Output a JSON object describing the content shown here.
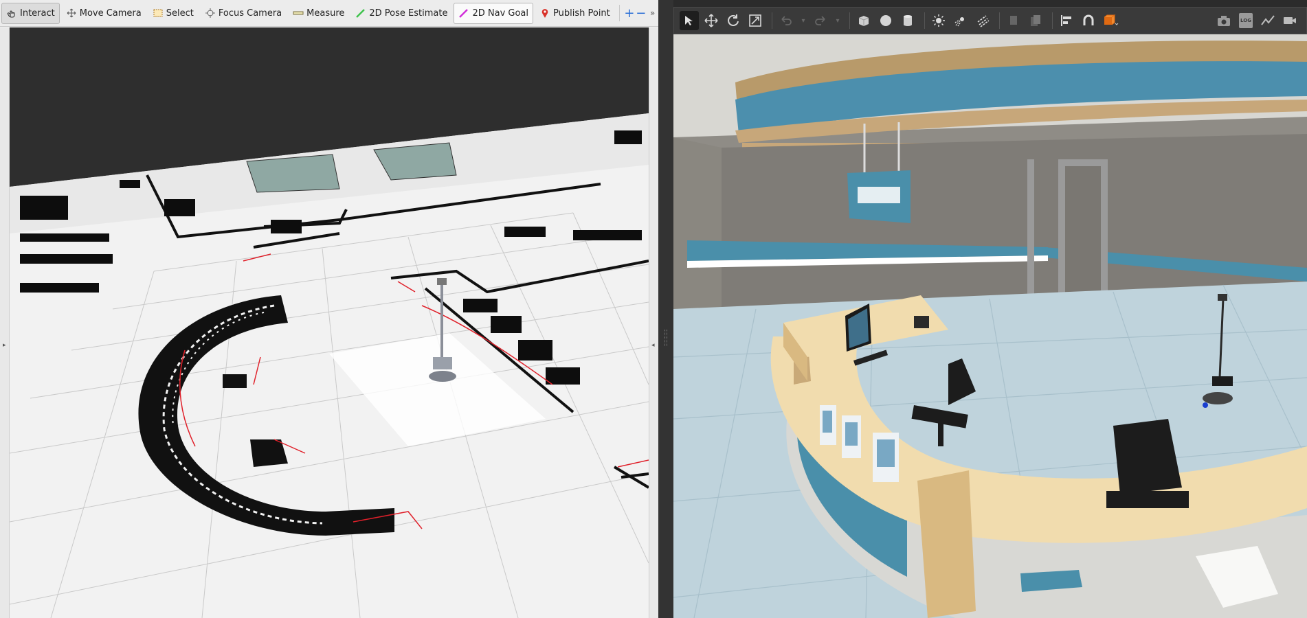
{
  "rviz": {
    "toolbar": {
      "tools": [
        {
          "label": "Interact",
          "icon": "hand-pointer-icon",
          "state": "active"
        },
        {
          "label": "Move Camera",
          "icon": "move-camera-icon"
        },
        {
          "label": "Select",
          "icon": "select-box-icon"
        },
        {
          "label": "Focus Camera",
          "icon": "focus-target-icon"
        },
        {
          "label": "Measure",
          "icon": "ruler-icon"
        },
        {
          "label": "2D Pose Estimate",
          "icon": "green-arrow-icon"
        },
        {
          "label": "2D Nav Goal",
          "icon": "magenta-arrow-icon",
          "state": "outlined"
        },
        {
          "label": "Publish Point",
          "icon": "map-pin-icon"
        }
      ],
      "add_tool_icon": "plus-icon",
      "remove_tool_icon": "minus-icon",
      "overflow_icon": "double-chevron-right-icon"
    }
  },
  "gazebo": {
    "toolbar": {
      "left_tools": [
        "select-mode-icon",
        "translate-mode-icon",
        "rotate-mode-icon",
        "scale-mode-icon",
        "undo-icon",
        "redo-icon",
        "box-icon",
        "sphere-icon",
        "cylinder-icon",
        "point-light-icon",
        "spot-light-icon",
        "directional-light-icon",
        "copy-icon",
        "paste-icon",
        "align-icon",
        "snap-icon",
        "view-angle-icon"
      ],
      "right_tools": [
        "screenshot-icon",
        "log-icon",
        "plot-icon",
        "video-record-icon"
      ],
      "log_label": "LOG"
    }
  },
  "colors": {
    "rviz_bg": "#efefef",
    "gazebo_bg": "#3a3a3a",
    "accent_blue": "#2a6fd6",
    "teal_wall": "#4a8faa",
    "desk_wood": "#f1dcae"
  }
}
